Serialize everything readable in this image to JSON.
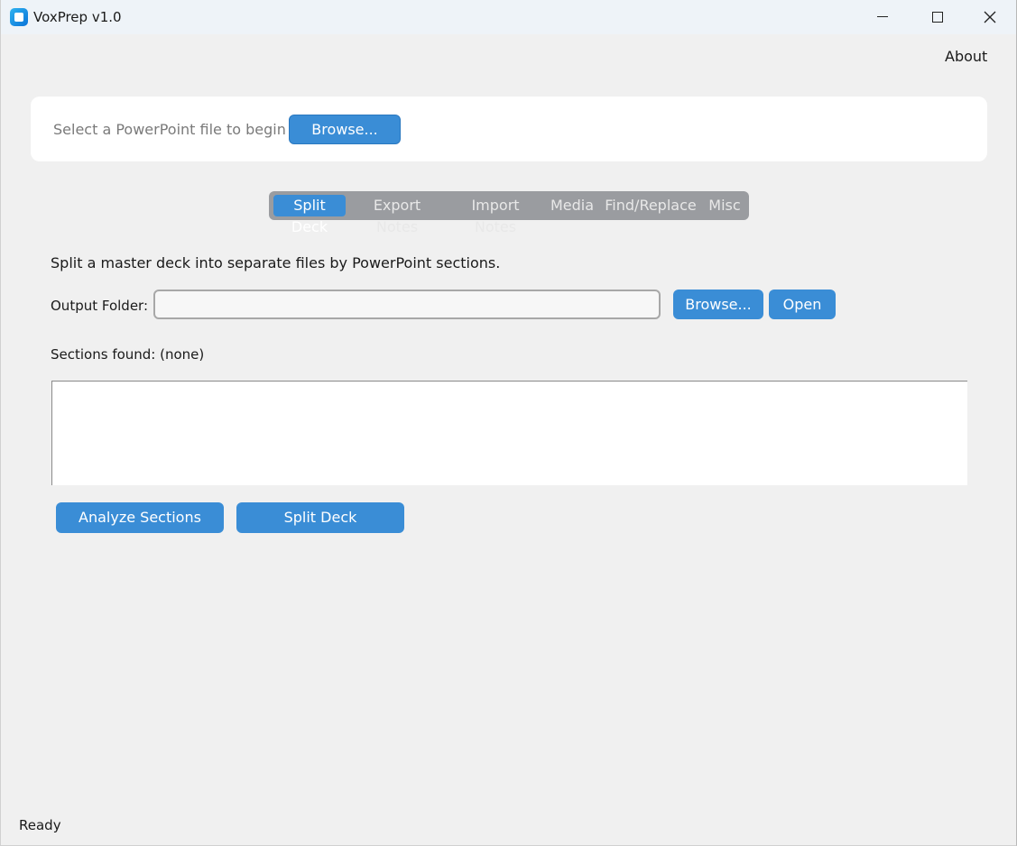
{
  "window": {
    "title": "VoxPrep v1.0"
  },
  "menu": {
    "about": "About"
  },
  "file_panel": {
    "prompt": "Select a PowerPoint file to begin",
    "browse_label": "Browse..."
  },
  "tabs": [
    {
      "label": "Split Deck",
      "active": true
    },
    {
      "label": "Export Notes",
      "active": false
    },
    {
      "label": "Import Notes",
      "active": false
    },
    {
      "label": "Media",
      "active": false
    },
    {
      "label": "Find/Replace",
      "active": false
    },
    {
      "label": "Misc",
      "active": false
    }
  ],
  "split_deck": {
    "description": "Split a master deck into separate files by PowerPoint sections.",
    "output_folder_label": "Output Folder:",
    "output_folder_value": "",
    "browse_label": "Browse...",
    "open_label": "Open",
    "sections_found_label": "Sections found: (none)",
    "sections": [],
    "analyze_label": "Analyze Sections",
    "split_label": "Split Deck"
  },
  "status_bar": {
    "text": "Ready"
  },
  "colors": {
    "accent": "#3a8dd6",
    "tab_bar": "#9a9ca0",
    "background": "#f0f0f0"
  },
  "icons": {
    "app": "app-icon",
    "minimize": "minimize-icon",
    "maximize": "maximize-icon",
    "close": "close-icon"
  }
}
